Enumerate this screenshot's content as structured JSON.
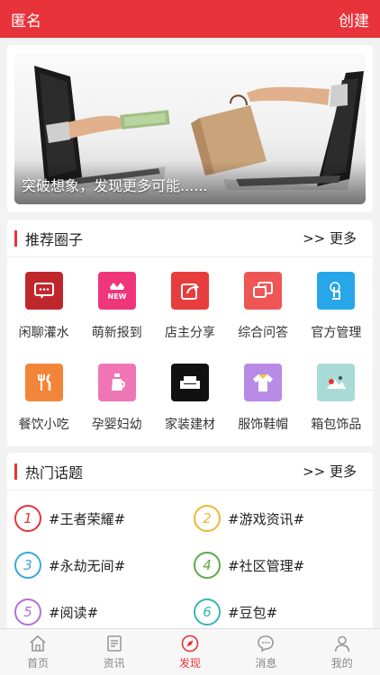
{
  "header": {
    "title": "匿名",
    "create_label": "创建",
    "color": "#e8333a"
  },
  "banner": {
    "caption": "突破想象，发现更多可能......"
  },
  "circles": {
    "title": "推荐圈子",
    "more": ">> 更多",
    "items": [
      {
        "label": "闲聊灌水",
        "icon": "chat-icon",
        "color": "#c0272d"
      },
      {
        "label": "萌新报到",
        "icon": "new-crown-icon",
        "color": "#f0367a"
      },
      {
        "label": "店主分享",
        "icon": "share-icon",
        "color": "#e83d3d"
      },
      {
        "label": "综合问答",
        "icon": "question-icon",
        "color": "#ee5656"
      },
      {
        "label": "官方管理",
        "icon": "touch-icon",
        "color": "#27a6ea"
      },
      {
        "label": "餐饮小吃",
        "icon": "cutlery-icon",
        "color": "#f3853a"
      },
      {
        "label": "孕婴妇幼",
        "icon": "bottle-icon",
        "color": "#f075b5"
      },
      {
        "label": "家装建材",
        "icon": "sofa-icon",
        "color": "#111111"
      },
      {
        "label": "服饰鞋帽",
        "icon": "tshirt-icon",
        "color": "#b78be6"
      },
      {
        "label": "箱包饰品",
        "icon": "landscape-icon",
        "color": "#a9dbd6"
      }
    ]
  },
  "topics": {
    "title": "热门话题",
    "more": ">> 更多",
    "items": [
      {
        "num": "1",
        "label": "#王者荣耀#",
        "color": "#e8333a"
      },
      {
        "num": "2",
        "label": "#游戏资讯#",
        "color": "#f0b72f"
      },
      {
        "num": "3",
        "label": "#永劫无间#",
        "color": "#3aa7dc"
      },
      {
        "num": "4",
        "label": "#社区管理#",
        "color": "#5aab45"
      },
      {
        "num": "5",
        "label": "#阅读#",
        "color": "#b36fd8"
      },
      {
        "num": "6",
        "label": "#豆包#",
        "color": "#36b8b0"
      }
    ]
  },
  "tabs": [
    {
      "label": "首页",
      "icon": "home-icon",
      "active": false
    },
    {
      "label": "资讯",
      "icon": "news-icon",
      "active": false
    },
    {
      "label": "发现",
      "icon": "compass-icon",
      "active": true
    },
    {
      "label": "消息",
      "icon": "message-icon",
      "active": false
    },
    {
      "label": "我的",
      "icon": "person-icon",
      "active": false
    }
  ]
}
